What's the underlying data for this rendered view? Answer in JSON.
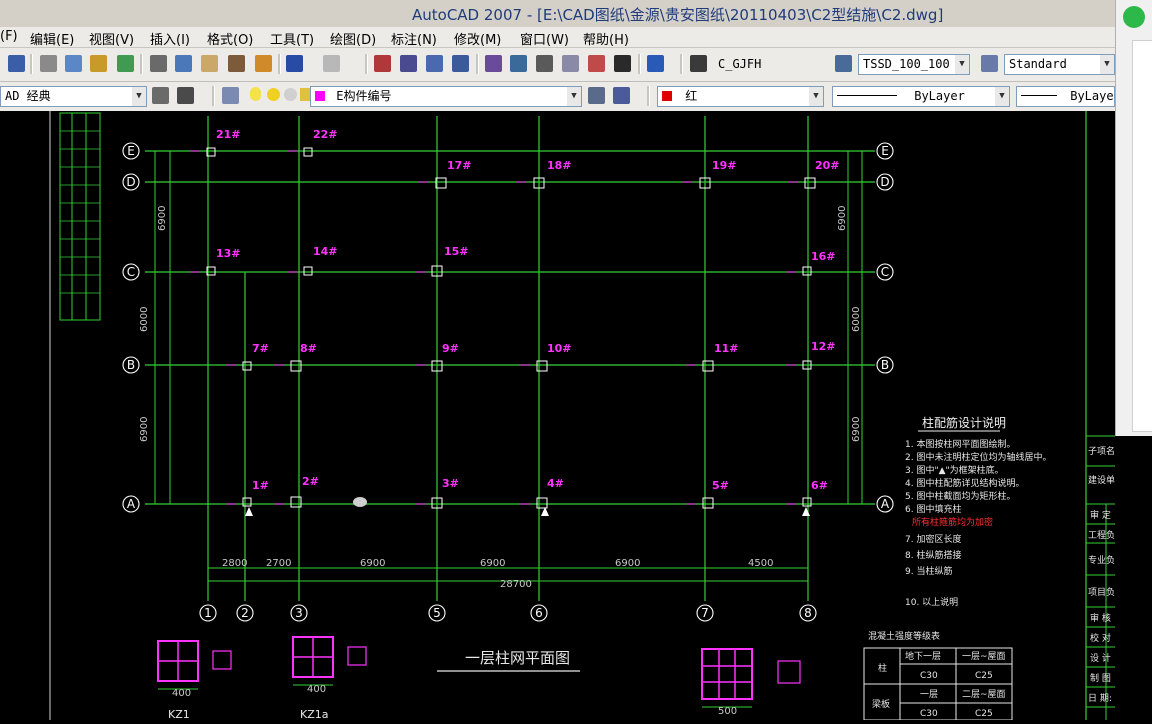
{
  "window": {
    "title": "AutoCAD 2007 - [E:\\CAD图纸\\金源\\贵安图纸\\20110403\\C2型结施\\C2.dwg]"
  },
  "menu": [
    "(F)",
    "编辑(E)",
    "视图(V)",
    "插入(I)",
    "格式(O)",
    "工具(T)",
    "绘图(D)",
    "标注(N)",
    "修改(M)",
    "窗口(W)",
    "帮助(H)"
  ],
  "toolbar": {
    "text_style": "C_GJFH",
    "dim_style": "TSSD_100_100",
    "table_style": "Standard",
    "workspace": "AD 经典",
    "layer": "E构件编号",
    "color": "红",
    "linetype": "ByLayer",
    "lineweight": "ByLayer"
  },
  "drawing": {
    "plan_title": "一层柱网平面图",
    "notes_title": "柱配筋设计说明",
    "rows": [
      "E",
      "D",
      "C",
      "B",
      "A"
    ],
    "columns": [
      "1",
      "2",
      "3",
      "5",
      "6",
      "7",
      "8"
    ],
    "column_labels": [
      "21#",
      "22#",
      "17#",
      "18#",
      "19#",
      "20#",
      "13#",
      "14#",
      "15#",
      "16#",
      "7#",
      "8#",
      "9#",
      "10#",
      "11#",
      "12#",
      "1#",
      "2#",
      "3#",
      "4#",
      "5#",
      "6#"
    ],
    "details": [
      "KZ1",
      "KZ1a"
    ],
    "detail_dims": [
      "400",
      "400",
      "500"
    ],
    "total_dim": "28700",
    "dims_bottom": [
      "2800",
      "2700",
      "6900",
      "6900",
      "6900",
      "4500"
    ],
    "dims_left": [
      "6000",
      "6900",
      "6900"
    ],
    "dims_right": [
      "6000",
      "6900",
      "6900"
    ],
    "notes": [
      "1. 本图按柱网平面图绘制。",
      "2. 图中未注明柱定位均为轴线居中。",
      "3. 图中\"▲\"为框架柱底。",
      "4. 图中柱配筋详见结构说明。",
      "5. 图中柱截面均为矩形柱。",
      "6. 图中填充柱",
      "7. 加密区长度",
      "8. 柱纵筋搭接",
      "9. 当柱纵筋",
      "10. 以上说明"
    ],
    "notes_red": "所有柱箍筋均为加密",
    "table": {
      "title": "混凝土强度等级表",
      "headers": [
        "柱",
        "地下一层",
        "一层~屋面"
      ],
      "rows": [
        [
          "",
          "C30",
          "C25"
        ],
        [
          "梁板",
          "一层",
          "二层~屋面"
        ],
        [
          "",
          "C30",
          "C25"
        ]
      ]
    },
    "title_block_labels": [
      "子项名称:",
      "建设单位:",
      "审 定",
      "工程负责人",
      "专业负责人",
      "项目负责人",
      "审 核",
      "校 对",
      "设 计",
      "制 图",
      "日 期:"
    ]
  },
  "colors": {
    "grid": "#35d035",
    "label": "#ff33ff",
    "red": "#e00000",
    "menu_bg": "#ecebe7"
  }
}
